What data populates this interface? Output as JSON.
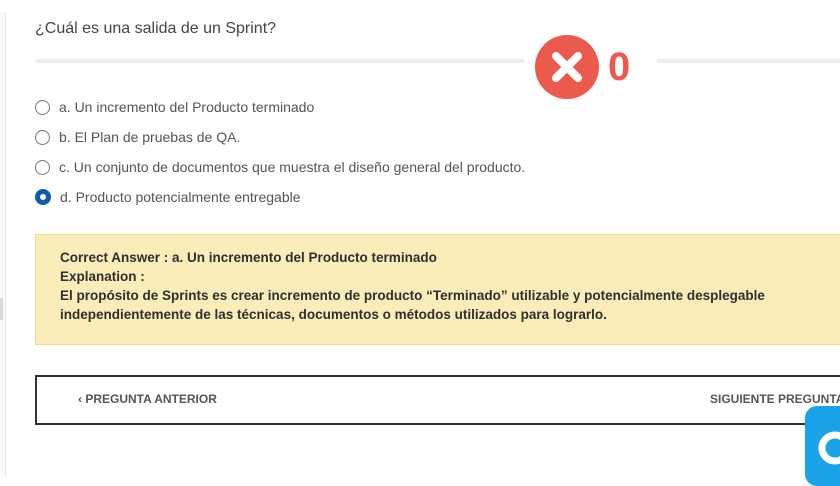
{
  "question": "¿Cuál es una salida de un Sprint?",
  "score": {
    "value": "0",
    "icon": "x-circle-icon",
    "color": "#ec5a4e"
  },
  "options": [
    {
      "label": "a. Un incremento del Producto terminado",
      "selected": false
    },
    {
      "label": "b. El Plan de pruebas de QA.",
      "selected": false
    },
    {
      "label": "c. Un conjunto de documentos que muestra el diseño general del producto.",
      "selected": false
    },
    {
      "label": "d. Producto potencialmente entregable",
      "selected": true
    }
  ],
  "feedback": {
    "correct_answer": "Correct Answer : a. Un incremento del Producto terminado",
    "explanation_label": "Explanation :",
    "explanation_text": "El propósito de Sprints es crear incremento de producto “Terminado” utilizable y potencialmente desplegable independientemente de las técnicas, documentos o métodos utilizados para lograrlo."
  },
  "navigation": {
    "prev": "‹ PREGUNTA ANTERIOR",
    "next": "SIGUIENTE PREGUNTA ›"
  },
  "colors": {
    "selected_radio": "#0d5caa",
    "feedback_bg": "#fbedb9",
    "chat_widget": "#1aa3e8"
  }
}
